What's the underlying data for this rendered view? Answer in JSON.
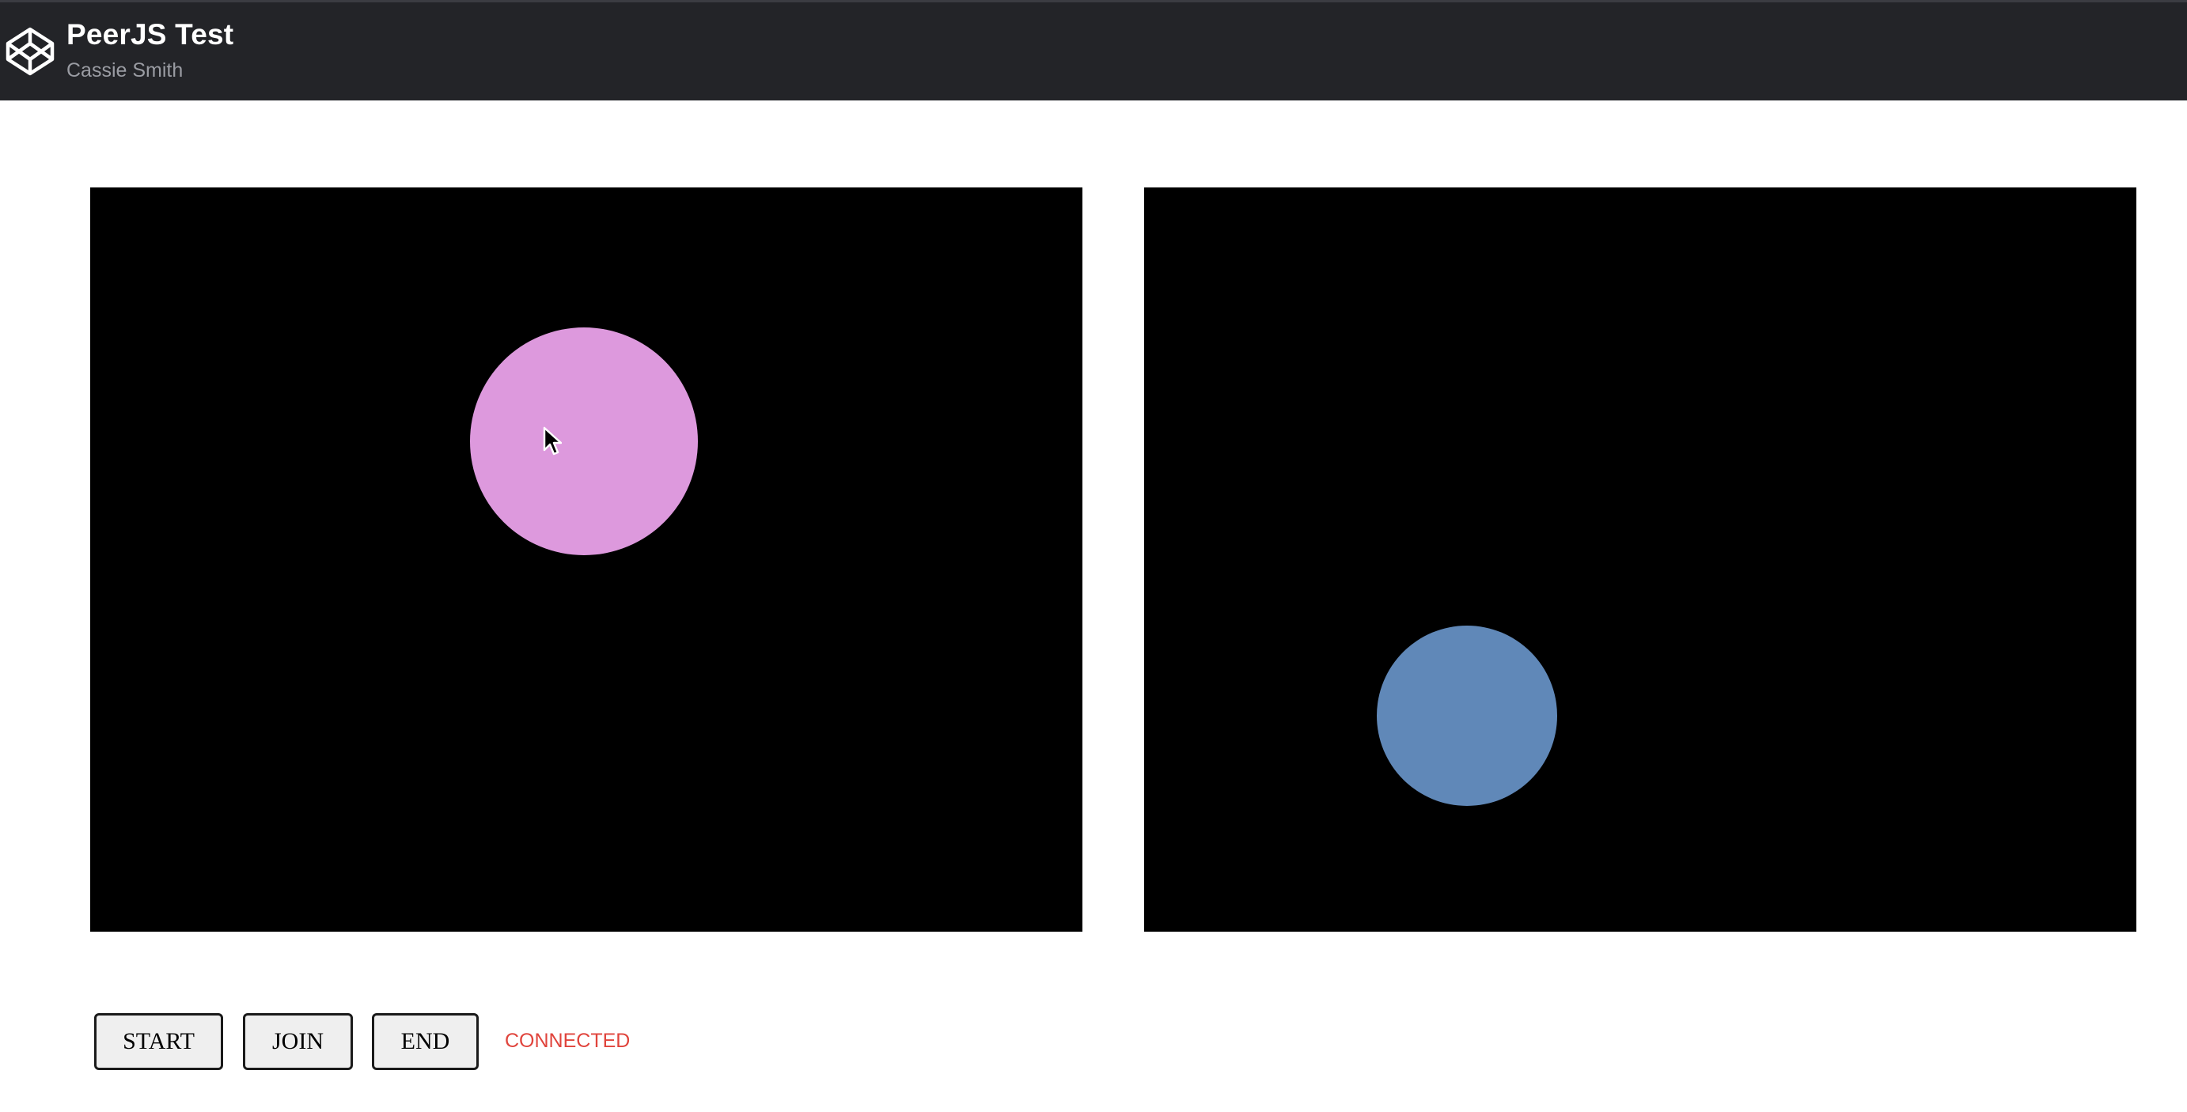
{
  "header": {
    "title": "PeerJS Test",
    "author": "Cassie Smith",
    "logo_icon": "codepen-logo-icon"
  },
  "canvases": {
    "local": {
      "circle_color": "#dd99dd"
    },
    "remote": {
      "circle_color": "#6088b8"
    }
  },
  "controls": {
    "start_label": "START",
    "join_label": "JOIN",
    "end_label": "END",
    "status_text": "CONNECTED",
    "status_color": "#e0443c"
  },
  "colors": {
    "topbar_bg": "#232428",
    "canvas_bg": "#000000"
  }
}
